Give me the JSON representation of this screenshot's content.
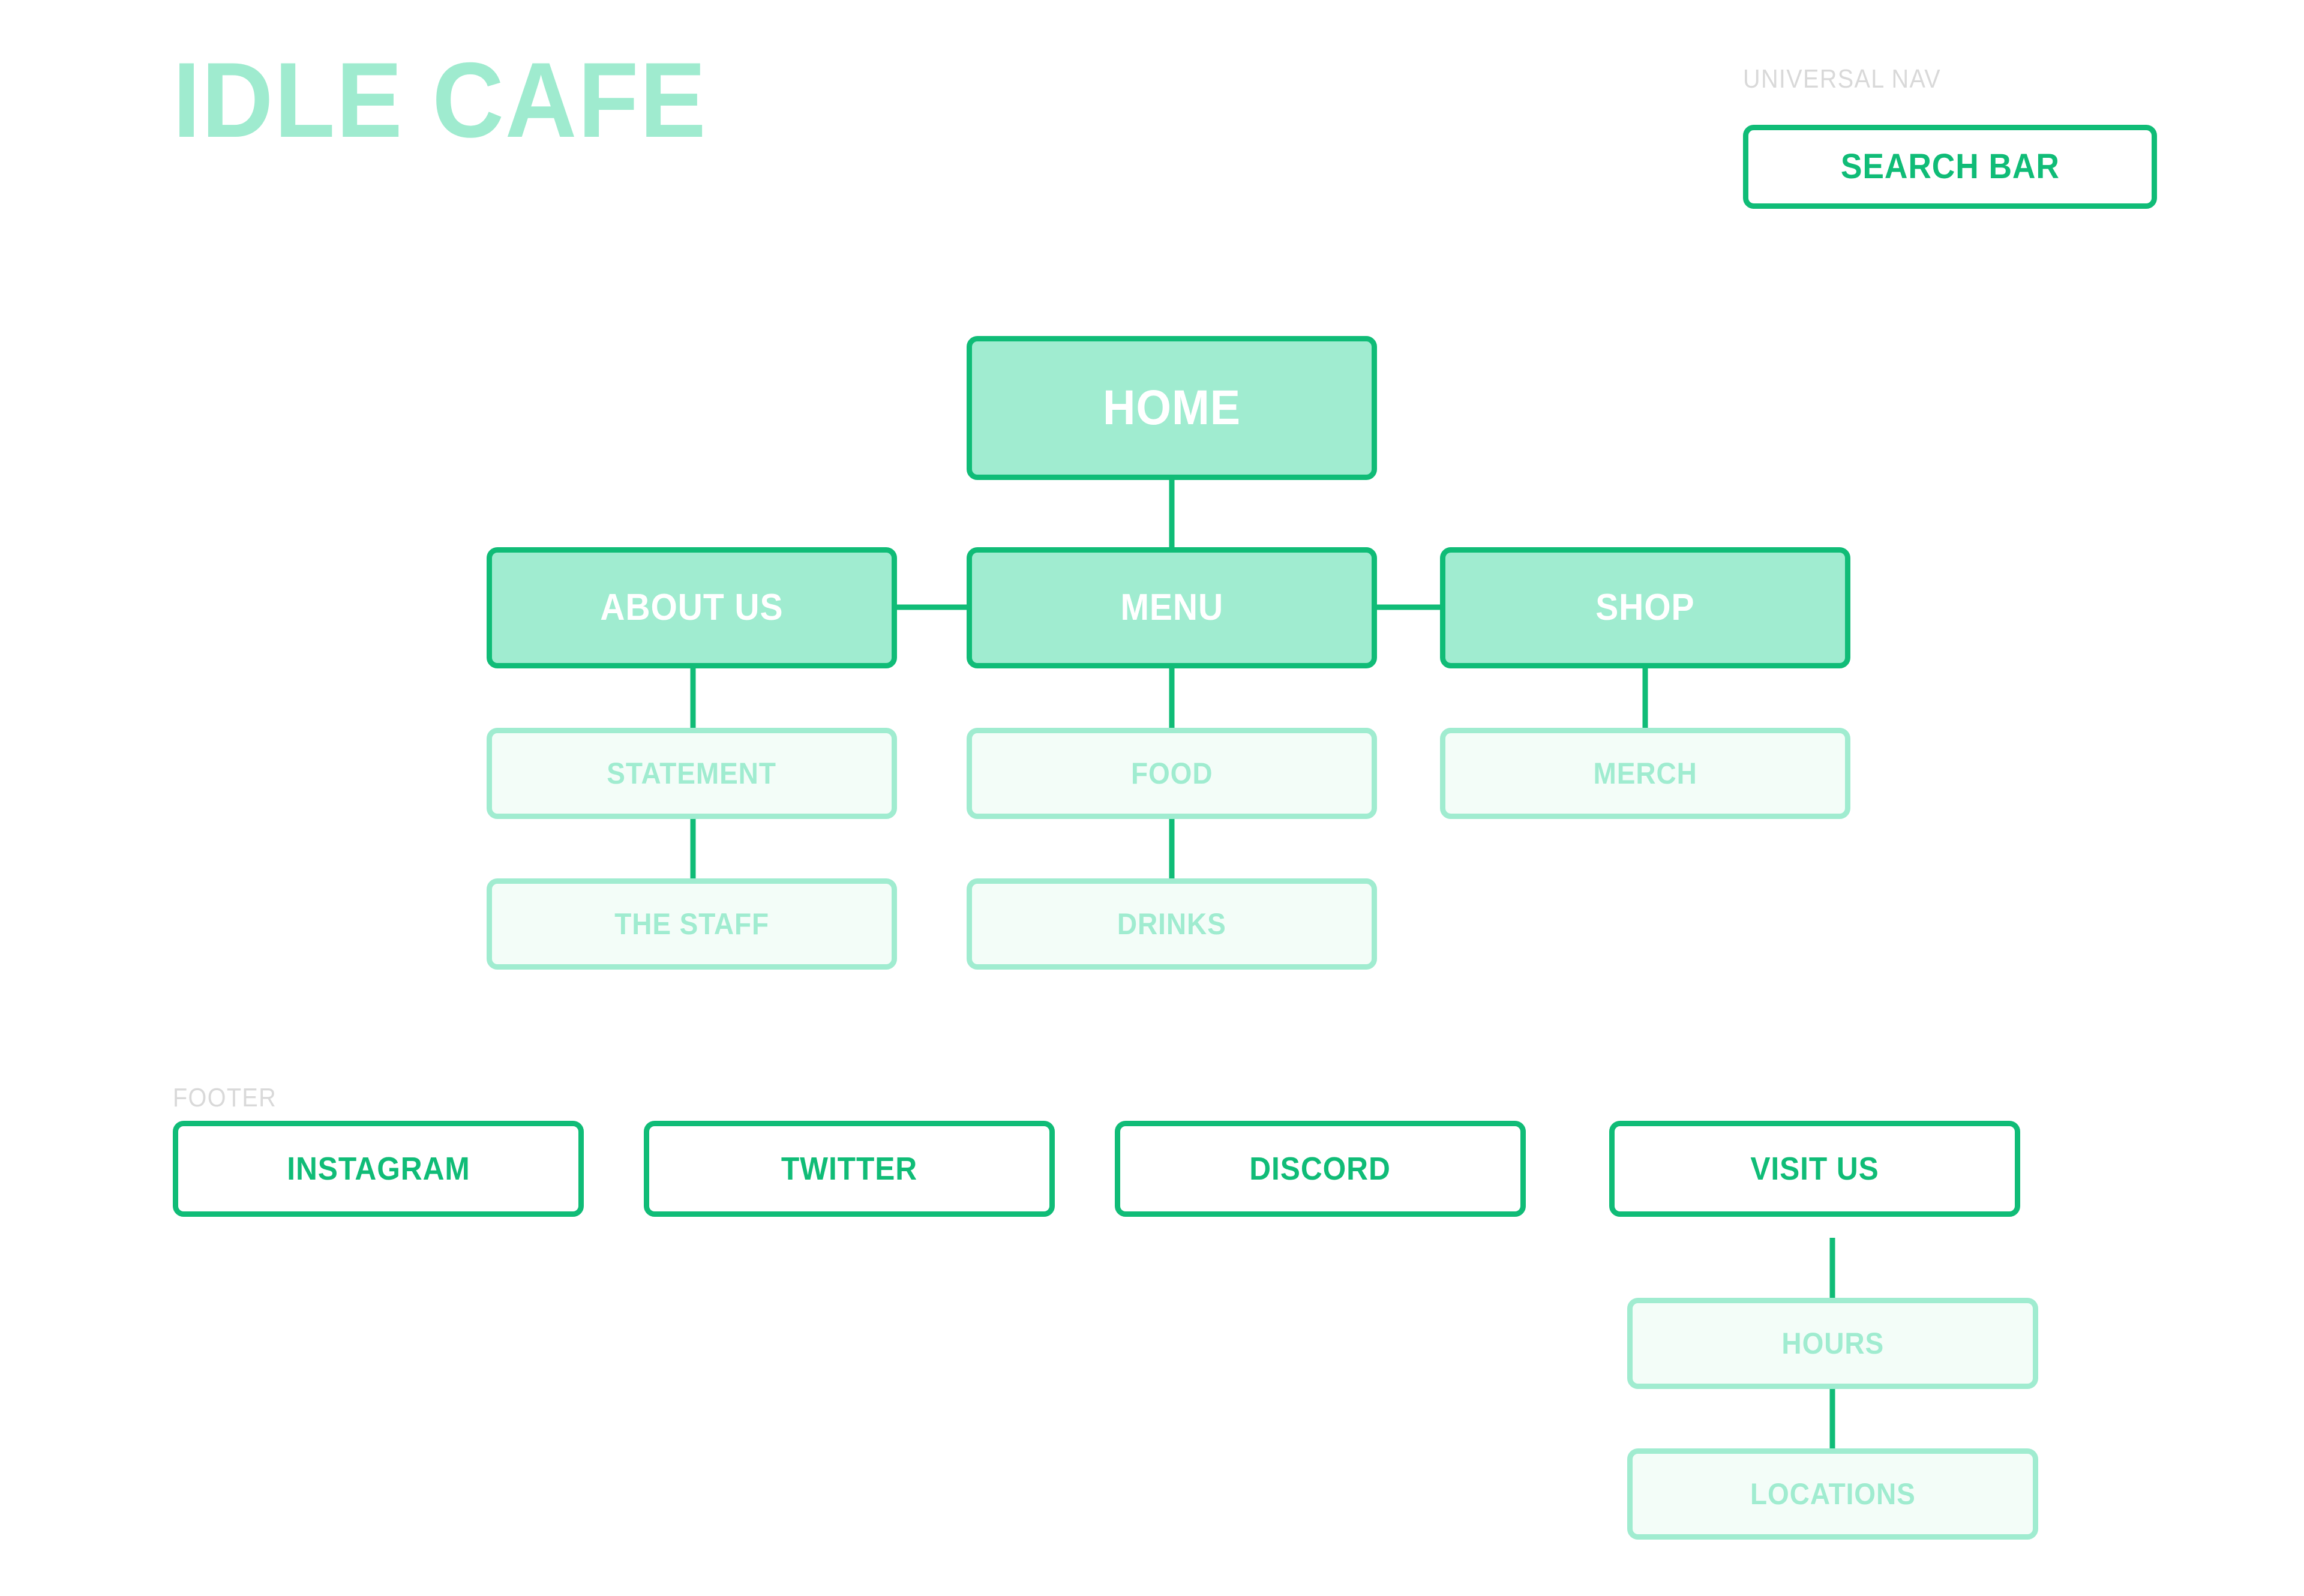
{
  "brand": {
    "title": "IDLE CAFE",
    "color": "#9FEBCF"
  },
  "labels": {
    "universal_nav": "UNIVERSAL NAV",
    "footer": "FOOTER",
    "color": "#D9D9D9"
  },
  "palette": {
    "accent_green": "#10BC77",
    "mint": "#A0ECD0",
    "pale_mint": "#F3FDF8",
    "white": "#FFFFFF",
    "gray_label": "#D9D9D9"
  },
  "universal_nav": {
    "search_bar_label": "SEARCH BAR"
  },
  "sitemap": {
    "root": {
      "label": "HOME",
      "level": 0
    },
    "level1": [
      {
        "label": "ABOUT US"
      },
      {
        "label": "MENU"
      },
      {
        "label": "SHOP"
      }
    ],
    "level2": {
      "about_us": [
        {
          "label": "STATEMENT"
        },
        {
          "label": "THE STAFF"
        }
      ],
      "menu": [
        {
          "label": "FOOD"
        },
        {
          "label": "DRINKS"
        }
      ],
      "shop": [
        {
          "label": "MERCH"
        }
      ]
    }
  },
  "footer": {
    "links": [
      {
        "label": "INSTAGRAM"
      },
      {
        "label": "TWITTER"
      },
      {
        "label": "DISCORD"
      },
      {
        "label": "VISIT US"
      }
    ],
    "visit_us_children": [
      {
        "label": "HOURS"
      },
      {
        "label": "LOCATIONS"
      }
    ]
  }
}
